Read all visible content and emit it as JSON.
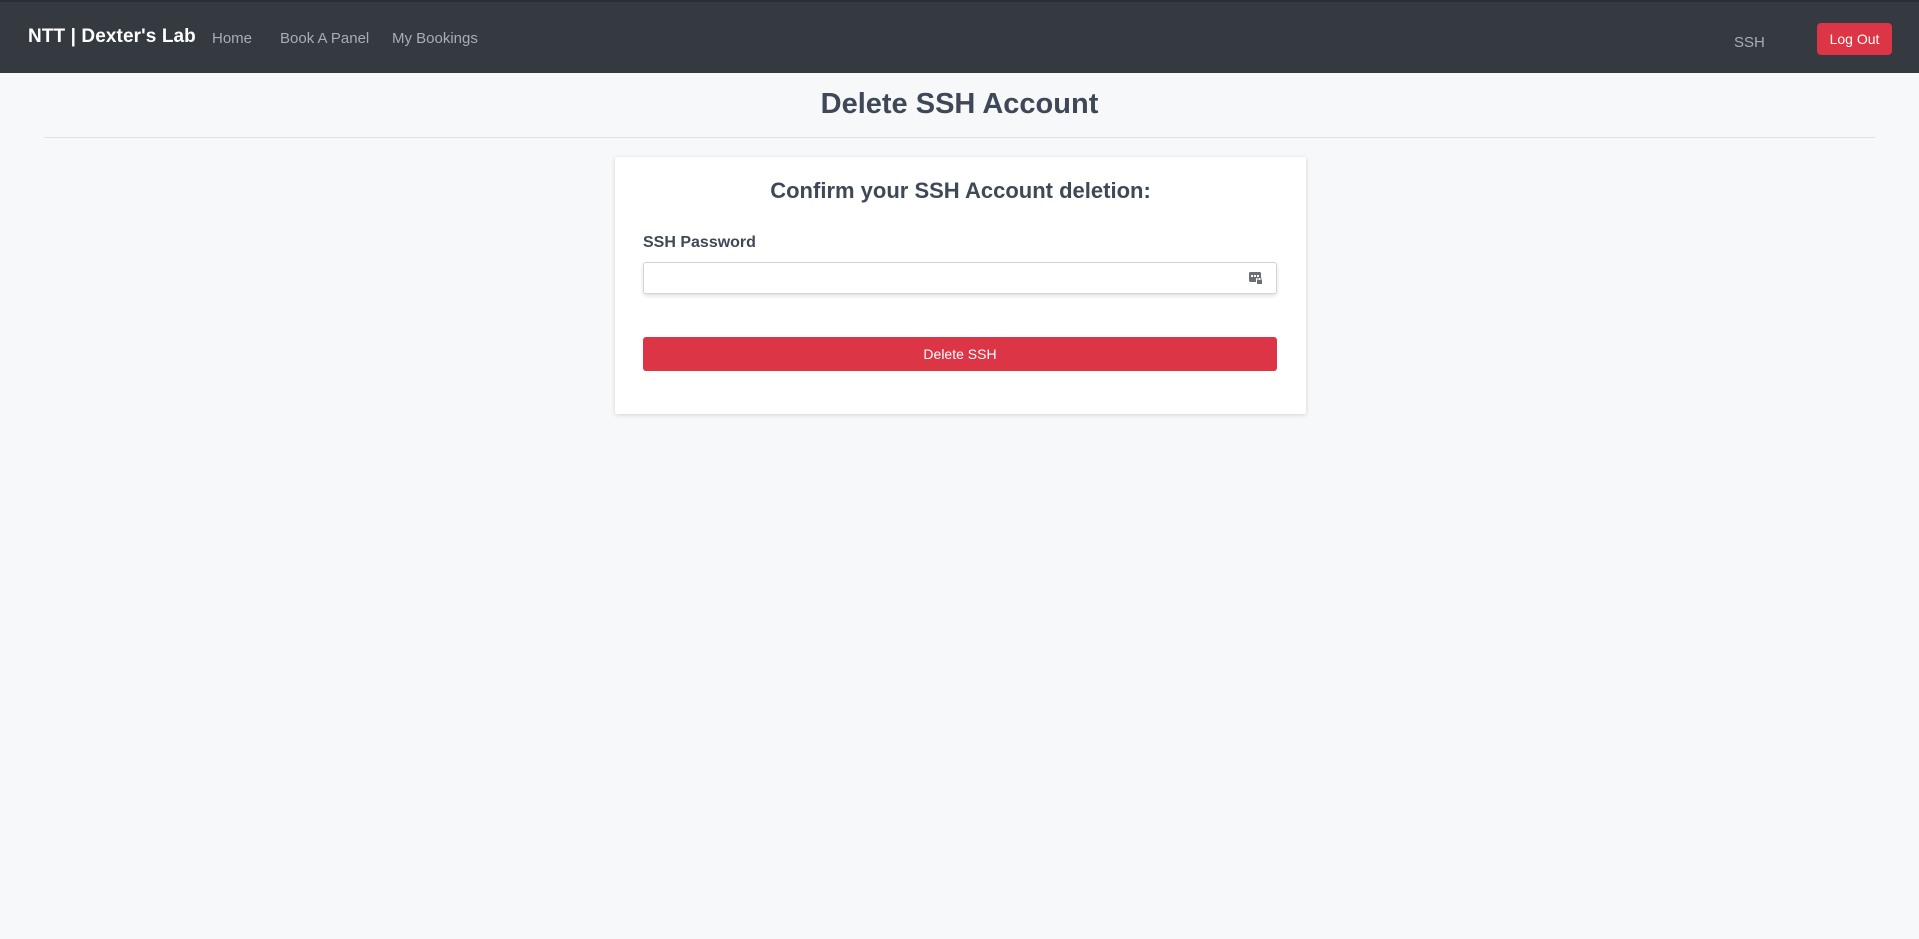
{
  "navbar": {
    "brand": "NTT | Dexter's Lab",
    "links": [
      {
        "label": "Home"
      },
      {
        "label": "Book A Panel"
      },
      {
        "label": "My Bookings"
      }
    ],
    "right_link": "SSH",
    "logout_label": "Log Out"
  },
  "page": {
    "title": "Delete SSH Account"
  },
  "card": {
    "heading": "Confirm your SSH Account deletion:",
    "password_label": "SSH Password",
    "password_value": "",
    "submit_label": "Delete SSH"
  },
  "colors": {
    "navbar_bg": "#343a40",
    "danger": "#dc3545",
    "page_bg": "#f7f8fa",
    "heading_text": "#3f4857"
  },
  "icons": {
    "password_field_icon": "password-manager-icon"
  }
}
